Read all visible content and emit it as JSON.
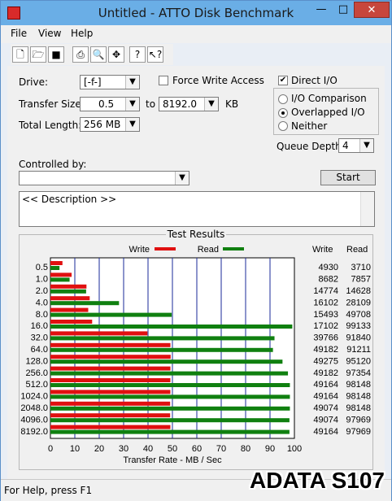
{
  "window": {
    "title": "Untitled - ATTO Disk Benchmark",
    "min_label": "—",
    "max_label": "□",
    "close_label": "✕"
  },
  "menus": [
    "File",
    "View",
    "Help"
  ],
  "toolbar": {
    "icons": [
      "new-file-icon",
      "open-folder-icon",
      "save-icon",
      "print-icon",
      "print-preview-icon",
      "move-icon",
      "help-icon",
      "context-help-icon"
    ]
  },
  "form": {
    "drive_label": "Drive:",
    "drive_value": "[-f-]",
    "transfer_size_label": "Transfer Size:",
    "transfer_from": "0.5",
    "to_label": "to",
    "transfer_to": "8192.0",
    "unit": "KB",
    "total_length_label": "Total Length:",
    "total_length_value": "256 MB",
    "force_write_label": "Force Write Access",
    "direct_io_label": "Direct I/O",
    "io_comparison_label": "I/O Comparison",
    "overlapped_io_label": "Overlapped I/O",
    "neither_label": "Neither",
    "queue_depth_label": "Queue Depth:",
    "queue_depth_value": "4",
    "controlled_by_label": "Controlled by:",
    "start_label": "Start",
    "description": "<< Description >>"
  },
  "results": {
    "group_title": "Test Results",
    "write_legend": "Write",
    "read_legend": "Read",
    "write_col": "Write",
    "read_col": "Read",
    "xlabel": "Transfer Rate - MB / Sec"
  },
  "chart_data": {
    "type": "bar",
    "categories": [
      "0.5",
      "1.0",
      "2.0",
      "4.0",
      "8.0",
      "16.0",
      "32.0",
      "64.0",
      "128.0",
      "256.0",
      "512.0",
      "1024.0",
      "2048.0",
      "4096.0",
      "8192.0"
    ],
    "series": [
      {
        "name": "Write",
        "values": [
          4930,
          8682,
          14774,
          16102,
          15493,
          17102,
          39766,
          49182,
          49275,
          49182,
          49164,
          49164,
          49074,
          49074,
          49164
        ],
        "color": "#e01010"
      },
      {
        "name": "Read",
        "values": [
          3710,
          7857,
          14628,
          28109,
          49708,
          99133,
          91840,
          91211,
          95120,
          97354,
          98148,
          98148,
          98148,
          97969,
          97969
        ],
        "color": "#108010"
      }
    ],
    "write_display": [
      "4930",
      "8682",
      "14774",
      "16102",
      "15493",
      "17102",
      "39766",
      "49182",
      "49275",
      "49182",
      "49164",
      "49164",
      "49074",
      "49074",
      "49164"
    ],
    "read_display": [
      "3710",
      "7857",
      "14628",
      "28109",
      "49708",
      "99133",
      "91840",
      "91211",
      "95120",
      "97354",
      "98148",
      "98148",
      "98148",
      "97969",
      "97969"
    ],
    "xlim": [
      0,
      100
    ],
    "xticks": [
      "0",
      "10",
      "20",
      "30",
      "40",
      "50",
      "60",
      "70",
      "80",
      "90",
      "100"
    ],
    "xlabel": "Transfer Rate - MB / Sec",
    "grid": true
  },
  "status": "For Help, press F1",
  "watermark": "ADATA S107"
}
